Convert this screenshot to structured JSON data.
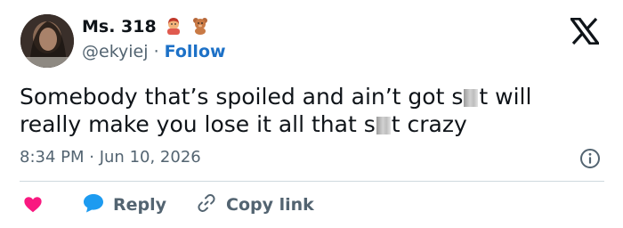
{
  "author": {
    "display_name": "Ms. 318",
    "handle": "@ekyiej",
    "separator": "·",
    "follow_label": "Follow"
  },
  "tweet": {
    "line1_before": "Somebody that’s spoiled and ain’t got s",
    "line1_after": "t will",
    "line2_before": "really make you lose it all that s",
    "line2_after": "t crazy"
  },
  "meta": {
    "time": "8:34 PM",
    "separator": "·",
    "date": "Jun 10, 2026"
  },
  "actions": {
    "reply_label": "Reply",
    "copy_label": "Copy link"
  },
  "colors": {
    "link": "#1d71c7",
    "heart": "#f91880",
    "reply_bubble": "#1d9bf0",
    "secondary_text": "#536471"
  },
  "icons": {
    "brand": "x-logo",
    "info": "info-icon",
    "like": "heart-icon",
    "reply": "speech-bubble-icon",
    "copy": "link-icon"
  }
}
